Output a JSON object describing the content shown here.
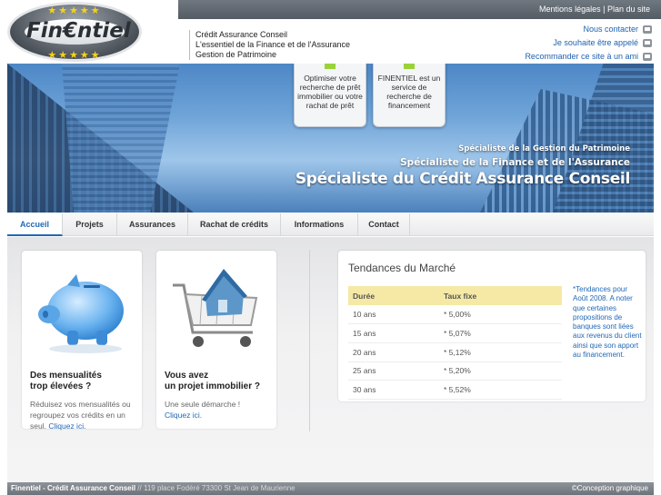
{
  "top_links": {
    "legal": "Mentions légales",
    "separator": "|",
    "sitemap": "Plan du site"
  },
  "logo": {
    "text": "Fin€ntiel",
    "stars": "★★★★★"
  },
  "tagline": [
    "Crédit Assurance Conseil",
    "L'essentiel de la Finance et de l'Assurance",
    "Gestion de Patrimoine"
  ],
  "contact_links": [
    {
      "label": "Nous contacter",
      "icon": "mail-icon"
    },
    {
      "label": "Je souhaite être appelé",
      "icon": "phone-icon"
    },
    {
      "label": "Recommander ce site à un ami",
      "icon": "share-icon"
    }
  ],
  "banner": {
    "bubble1": "Optimiser votre recherche de prêt immobilier ou votre rachat de prêt",
    "bubble2": "FINENTIEL est un service de recherche de financement",
    "spec1": "Spécialiste de la Gestion du Patrimoine",
    "spec2": "Spécialiste de la Finance et de l'Assurance",
    "spec3": "Spécialiste du Crédit Assurance Conseil"
  },
  "nav": [
    "Accueil",
    "Projets",
    "Assurances",
    "Rachat de crédits",
    "Informations",
    "Contact"
  ],
  "card1": {
    "title_line1": "Des mensualités",
    "title_line2": "trop élevées ?",
    "text": "Réduisez vos mensualités ou regroupez vos crédits en un seul.",
    "link": "Cliquez ici."
  },
  "card2": {
    "title_line1": "Vous avez",
    "title_line2": "un projet immobilier ?",
    "text": "Une seule démarche !",
    "link": "Cliquez ici."
  },
  "tendances": {
    "title": "Tendances du Marché",
    "headers": [
      "Durée",
      "Taux fixe"
    ],
    "rows": [
      {
        "duree": "10 ans",
        "taux": "* 5,00%"
      },
      {
        "duree": "15 ans",
        "taux": "* 5,07%"
      },
      {
        "duree": "20 ans",
        "taux": "* 5,12%"
      },
      {
        "duree": "25 ans",
        "taux": "* 5,20%"
      },
      {
        "duree": "30 ans",
        "taux": "* 5,52%"
      }
    ],
    "note": "*Tendances pour Août 2008. A noter que certaines propositions de banques sont liées aux revenus du client ainsi que son apport au financement."
  },
  "footer": {
    "left_bold": "Finentiel - Crédit Assurance Conseil",
    "left_rest": " // 119 place Fodéré 73300 St Jean de Maurienne",
    "right": "©Conception graphique"
  },
  "colors": {
    "accent": "#2169b6",
    "star": "#f4d21a",
    "table_header": "#f5e9a5"
  }
}
